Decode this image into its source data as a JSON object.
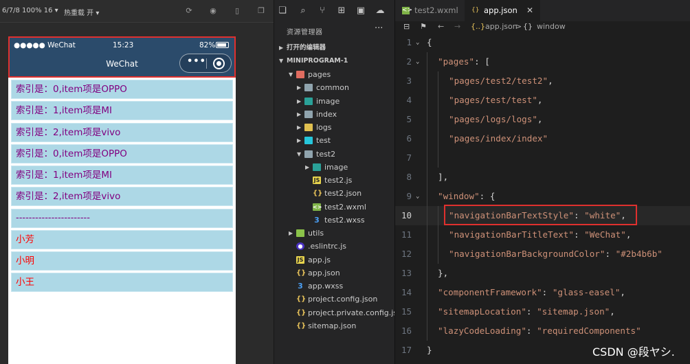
{
  "simulator": {
    "device_label": "6/7/8 100% 16",
    "hot_reload_label": "热重载 开",
    "status": {
      "signal": "●●●●● WeChat",
      "time": "15:23",
      "battery": "82%"
    },
    "nav_title": "WeChat",
    "capsule_dots": "•••",
    "rows": [
      {
        "text": "索引是：0,item项是OPPO",
        "color": "purple"
      },
      {
        "text": "索引是：1,item项是MI",
        "color": "purple"
      },
      {
        "text": "索引是：2,item项是vivo",
        "color": "purple"
      },
      {
        "text": "索引是：0,item项是OPPO",
        "color": "purple"
      },
      {
        "text": "索引是：1,item项是MI",
        "color": "purple"
      },
      {
        "text": "索引是：2,item项是vivo",
        "color": "purple"
      },
      {
        "text": "-----------------------",
        "color": "purple"
      },
      {
        "text": "小芳",
        "color": "red"
      },
      {
        "text": "小明",
        "color": "red"
      },
      {
        "text": "小王",
        "color": "red"
      }
    ],
    "colors": {
      "navbar": "#2b4b6b",
      "row_bg": "#add8e6",
      "row_purple": "#800080",
      "row_red": "#ff0000",
      "highlight": "#e0302e"
    }
  },
  "explorer": {
    "header": "资源管理器",
    "more": "···",
    "open_editors": "打开的编辑器",
    "project": "MINIPROGRAM-1",
    "tree": [
      {
        "label": "pages",
        "depth": 1,
        "caret": "open",
        "icon": "folder-red"
      },
      {
        "label": "common",
        "depth": 2,
        "caret": "closed",
        "icon": "folder-grey"
      },
      {
        "label": "image",
        "depth": 2,
        "caret": "closed",
        "icon": "folder-teal"
      },
      {
        "label": "index",
        "depth": 2,
        "caret": "closed",
        "icon": "folder-grey"
      },
      {
        "label": "logs",
        "depth": 2,
        "caret": "closed",
        "icon": "folder-yellow"
      },
      {
        "label": "test",
        "depth": 2,
        "caret": "closed",
        "icon": "folder-cyan"
      },
      {
        "label": "test2",
        "depth": 2,
        "caret": "open",
        "icon": "folder-grey"
      },
      {
        "label": "image",
        "depth": 3,
        "caret": "closed",
        "icon": "folder-teal"
      },
      {
        "label": "test2.js",
        "depth": 3,
        "caret": "none",
        "icon": "js"
      },
      {
        "label": "test2.json",
        "depth": 3,
        "caret": "none",
        "icon": "json"
      },
      {
        "label": "test2.wxml",
        "depth": 3,
        "caret": "none",
        "icon": "wxml"
      },
      {
        "label": "test2.wxss",
        "depth": 3,
        "caret": "none",
        "icon": "wxss"
      },
      {
        "label": "utils",
        "depth": 1,
        "caret": "closed",
        "icon": "folder-green"
      },
      {
        "label": ".eslintrc.js",
        "depth": 1,
        "caret": "none",
        "icon": "eslint"
      },
      {
        "label": "app.js",
        "depth": 1,
        "caret": "none",
        "icon": "js"
      },
      {
        "label": "app.json",
        "depth": 1,
        "caret": "none",
        "icon": "json"
      },
      {
        "label": "app.wxss",
        "depth": 1,
        "caret": "none",
        "icon": "wxss"
      },
      {
        "label": "project.config.json",
        "depth": 1,
        "caret": "none",
        "icon": "json"
      },
      {
        "label": "project.private.config.js...",
        "depth": 1,
        "caret": "none",
        "icon": "json"
      },
      {
        "label": "sitemap.json",
        "depth": 1,
        "caret": "none",
        "icon": "json"
      }
    ]
  },
  "editor": {
    "tabs": [
      {
        "label": "test2.wxml",
        "active": false,
        "icon": "wxml"
      },
      {
        "label": "app.json",
        "active": true,
        "icon": "json"
      }
    ],
    "close_glyph": "✕",
    "breadcrumb": {
      "file": "app.json",
      "sep": ">",
      "node": "window"
    },
    "current_line": 10,
    "lines": [
      {
        "n": "1",
        "fold": true,
        "indent": 0,
        "parts": [
          [
            "k",
            "{"
          ]
        ]
      },
      {
        "n": "2",
        "fold": true,
        "indent": 1,
        "parts": [
          [
            "s",
            "\"pages\""
          ],
          [
            "k",
            ": ["
          ]
        ]
      },
      {
        "n": "3",
        "fold": false,
        "indent": 2,
        "parts": [
          [
            "s",
            "\"pages/test2/test2\""
          ],
          [
            "k",
            ","
          ]
        ]
      },
      {
        "n": "4",
        "fold": false,
        "indent": 2,
        "parts": [
          [
            "s",
            "\"pages/test/test\""
          ],
          [
            "k",
            ","
          ]
        ]
      },
      {
        "n": "5",
        "fold": false,
        "indent": 2,
        "parts": [
          [
            "s",
            "\"pages/logs/logs\""
          ],
          [
            "k",
            ","
          ]
        ]
      },
      {
        "n": "6",
        "fold": false,
        "indent": 2,
        "parts": [
          [
            "s",
            "\"pages/index/index\""
          ]
        ]
      },
      {
        "n": "7",
        "fold": false,
        "indent": 2,
        "parts": []
      },
      {
        "n": "8",
        "fold": false,
        "indent": 1,
        "parts": [
          [
            "k",
            "],"
          ]
        ]
      },
      {
        "n": "9",
        "fold": true,
        "indent": 1,
        "parts": [
          [
            "s",
            "\"window\""
          ],
          [
            "k",
            ": {"
          ]
        ]
      },
      {
        "n": "10",
        "fold": false,
        "indent": 2,
        "parts": [
          [
            "s",
            "\"navigationBarTextStyle\""
          ],
          [
            "k",
            ": "
          ],
          [
            "s",
            "\"white\""
          ],
          [
            "k",
            ","
          ]
        ]
      },
      {
        "n": "11",
        "fold": false,
        "indent": 2,
        "parts": [
          [
            "s",
            "\"navigationBarTitleText\""
          ],
          [
            "k",
            ": "
          ],
          [
            "s",
            "\"WeChat\""
          ],
          [
            "k",
            ","
          ]
        ]
      },
      {
        "n": "12",
        "fold": false,
        "indent": 2,
        "parts": [
          [
            "s",
            "\"navigationBarBackgroundColor\""
          ],
          [
            "k",
            ": "
          ],
          [
            "s",
            "\"#2b4b6b\""
          ]
        ]
      },
      {
        "n": "13",
        "fold": false,
        "indent": 1,
        "parts": [
          [
            "k",
            "},"
          ]
        ]
      },
      {
        "n": "14",
        "fold": false,
        "indent": 1,
        "parts": [
          [
            "s",
            "\"componentFramework\""
          ],
          [
            "k",
            ": "
          ],
          [
            "s",
            "\"glass-easel\""
          ],
          [
            "k",
            ","
          ]
        ]
      },
      {
        "n": "15",
        "fold": false,
        "indent": 1,
        "parts": [
          [
            "s",
            "\"sitemapLocation\""
          ],
          [
            "k",
            ": "
          ],
          [
            "s",
            "\"sitemap.json\""
          ],
          [
            "k",
            ","
          ]
        ]
      },
      {
        "n": "16",
        "fold": false,
        "indent": 1,
        "parts": [
          [
            "s",
            "\"lazyCodeLoading\""
          ],
          [
            "k",
            ": "
          ],
          [
            "s",
            "\"requiredComponents\""
          ]
        ]
      },
      {
        "n": "17",
        "fold": false,
        "indent": 0,
        "parts": [
          [
            "k",
            "}"
          ]
        ]
      }
    ],
    "colors": {
      "string": "#ce9178",
      "punct": "#d4d4d4",
      "background": "#1e1e1e"
    }
  },
  "watermark": "CSDN @段ヤシ."
}
